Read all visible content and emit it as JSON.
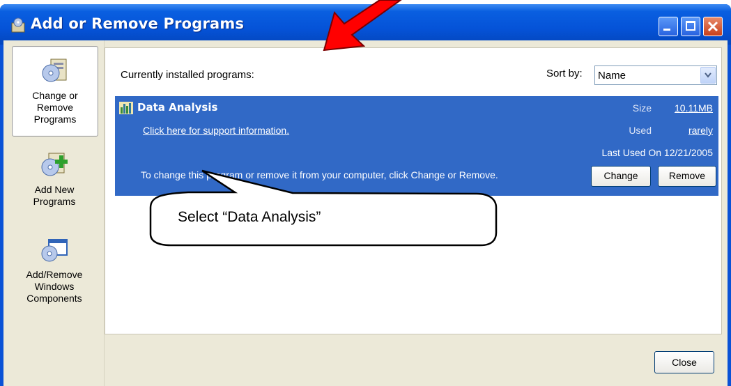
{
  "window": {
    "title": "Add or Remove Programs",
    "minimize_icon": "minimize-icon",
    "maximize_icon": "maximize-icon",
    "close_icon": "close-icon"
  },
  "taskpane": {
    "items": [
      {
        "label": "Change or\nRemove\nPrograms",
        "icon": "change-remove-programs-icon",
        "selected": true
      },
      {
        "label": "Add New\nPrograms",
        "icon": "add-new-programs-icon",
        "selected": false
      },
      {
        "label": "Add/Remove\nWindows\nComponents",
        "icon": "windows-components-icon",
        "selected": false
      }
    ]
  },
  "main": {
    "installed_label": "Currently installed programs:",
    "sort_label": "Sort by:",
    "sort_value": "Name",
    "program": {
      "name": "Data Analysis",
      "support_link": "Click here for support information.",
      "size_label": "Size",
      "size_value": "10.11MB",
      "used_label": "Used",
      "used_value": "rarely",
      "last_used": "Last Used On 12/21/2005",
      "change_hint": "To change this program or remove it from your computer, click Change or Remove.",
      "change_button": "Change",
      "remove_button": "Remove"
    }
  },
  "footer": {
    "close_button": "Close"
  },
  "annotation": {
    "callout_text": "Select “Data Analysis”",
    "arrow_color": "#ff0000"
  },
  "colors": {
    "selection": "#3169c6",
    "titlebar": "#0553d8",
    "pane_bg": "#ece9d8"
  }
}
